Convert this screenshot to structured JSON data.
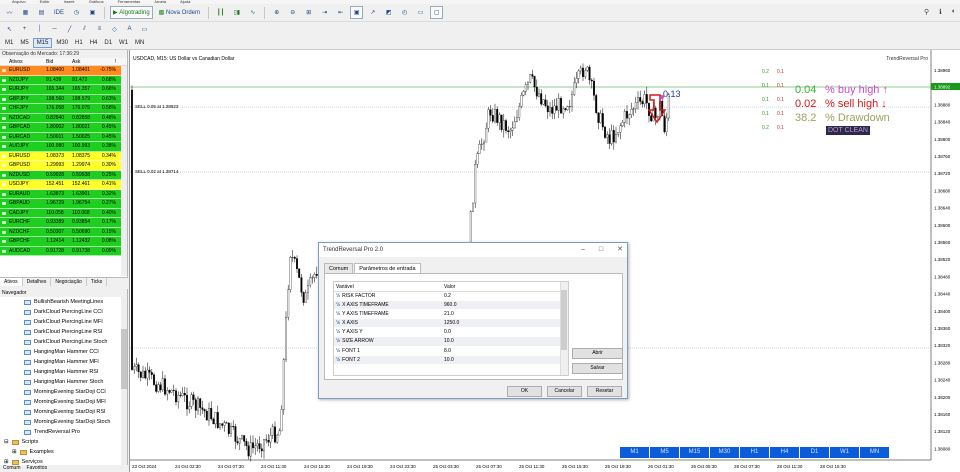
{
  "menu": [
    "Arquivo",
    "Exibir",
    "Inserir",
    "Gráficos",
    "Ferramentas",
    "Janela",
    "Ajuda"
  ],
  "toolbar": {
    "algo_label": "Algotrading",
    "new_order_label": "Nova Ordem",
    "ide_label": "IDE"
  },
  "timeframes": [
    "M1",
    "M5",
    "M15",
    "M30",
    "H1",
    "H4",
    "D1",
    "W1",
    "MN"
  ],
  "active_timeframe": "M15",
  "market_watch": {
    "title": "Observação do Mercado: 17:36:29",
    "headers": [
      "Ativos",
      "Bid",
      "Ask",
      "!"
    ],
    "rows": [
      {
        "symbol": "EURUSD",
        "bid": "1.08400",
        "ask": "1.08401",
        "chg": "-0.75%",
        "color": "#ff8a1e"
      },
      {
        "symbol": "NZDJPY",
        "bid": "91.439",
        "ask": "91.472",
        "chg": "0.68%",
        "color": "#1fcf1f"
      },
      {
        "symbol": "EURJPY",
        "bid": "165.344",
        "ask": "165.357",
        "chg": "0.66%",
        "color": "#1fcf1f"
      },
      {
        "symbol": "GBPJPY",
        "bid": "198.560",
        "ask": "198.579",
        "chg": "0.63%",
        "color": "#1fcf1f"
      },
      {
        "symbol": "CHFJPY",
        "bid": "176.058",
        "ask": "176.075",
        "chg": "0.58%",
        "color": "#1fcf1f"
      },
      {
        "symbol": "NZDCAD",
        "bid": "0.82840",
        "ask": "0.82858",
        "chg": "0.48%",
        "color": "#1fcf1f"
      },
      {
        "symbol": "GBPCAD",
        "bid": "1.80002",
        "ask": "1.80021",
        "chg": "0.45%",
        "color": "#1fcf1f"
      },
      {
        "symbol": "EURCAD",
        "bid": "1.50011",
        "ask": "1.50025",
        "chg": "0.45%",
        "color": "#1fcf1f"
      },
      {
        "symbol": "AUDJPY",
        "bid": "100.980",
        "ask": "100.993",
        "chg": "0.38%",
        "color": "#1fcf1f"
      },
      {
        "symbol": "EURUSD",
        "bid": "1.08373",
        "ask": "1.08375",
        "chg": "0.34%",
        "color": "#ffff2a"
      },
      {
        "symbol": "GBPUSD",
        "bid": "1.29993",
        "ask": "1.29974",
        "chg": "0.30%",
        "color": "#ffff2a"
      },
      {
        "symbol": "NZDUSD",
        "bid": "0.59928",
        "ask": "0.59938",
        "chg": "0.25%",
        "color": "#1fcf1f"
      },
      {
        "symbol": "USDJPY",
        "bid": "152.451",
        "ask": "152.461",
        "chg": "0.41%",
        "color": "#ffff2a"
      },
      {
        "symbol": "EURAUD",
        "bid": "1.63873",
        "ask": "1.63901",
        "chg": "0.32%",
        "color": "#1fcf1f"
      },
      {
        "symbol": "GBPAUD",
        "bid": "1.96729",
        "ask": "1.96754",
        "chg": "0.27%",
        "color": "#1fcf1f"
      },
      {
        "symbol": "CADJPY",
        "bid": "110.058",
        "ask": "110.068",
        "chg": "0.40%",
        "color": "#1fcf1f"
      },
      {
        "symbol": "EURCHF",
        "bid": "0.93389",
        "ask": "0.93854",
        "chg": "0.17%",
        "color": "#1fcf1f"
      },
      {
        "symbol": "NZDCHF",
        "bid": "0.50307",
        "ask": "0.50690",
        "chg": "0.15%",
        "color": "#1fcf1f"
      },
      {
        "symbol": "GBPCHF",
        "bid": "1.12414",
        "ask": "1.12432",
        "chg": "0.08%",
        "color": "#1fcf1f"
      },
      {
        "symbol": "AUDCAD",
        "bid": "0.91728",
        "ask": "0.91738",
        "chg": "0.09%",
        "color": "#1fcf1f"
      }
    ],
    "tabs": [
      "Ativos",
      "Detalhes",
      "Negociação",
      "Ticks"
    ]
  },
  "navigator": {
    "title": "Navegador",
    "items": [
      "BullishBearish MeetingLines",
      "DarkCloud PiercingLine CCI",
      "DarkCloud PiercingLine MFI",
      "DarkCloud PiercingLine RSI",
      "DarkCloud PiercingLine Stoch",
      "HangingMan Hammer CCI",
      "HangingMan Hammer MFI",
      "HangingMan Hammer RSI",
      "HangingMan Hammer Stoch",
      "MorningEvening StarDoji CCI",
      "MorningEvening StarDoji MFI",
      "MorningEvening StarDoji RSI",
      "MorningEvening StarDoji Stoch"
    ],
    "trend_item": "TrendReversal Pro",
    "scripts": "Scripts",
    "examples": "Examples",
    "services": "Serviços"
  },
  "bottom_tabs": [
    "Comum",
    "Favoritos"
  ],
  "chart": {
    "title": "USDCAD, M15: US Dollar vs Canadian Dollar",
    "brand": "TrendReversal Pro",
    "current_price": "1.38892",
    "price_labels": [
      "1.38960",
      "1.38920",
      "1.38880",
      "1.38840",
      "1.38800",
      "1.38760",
      "1.38720",
      "1.38680",
      "1.38640",
      "1.38600",
      "1.38560",
      "1.38520",
      "1.38480",
      "1.38440",
      "1.38400",
      "1.38360",
      "1.38320",
      "1.38280",
      "1.38240",
      "1.38200",
      "1.38160",
      "1.38120",
      "1.38080"
    ],
    "time_labels": [
      "23 Oct 2024",
      "24 Oct 02:30",
      "24 Oct 07:30",
      "24 Oct 11:30",
      "24 Oct 15:30",
      "24 Oct 19:30",
      "24 Oct 23:30",
      "25 Oct 03:30",
      "25 Oct 07:30",
      "25 Oct 11:30",
      "25 Oct 15:30",
      "25 Oct 19:30",
      "26 Oct 01:30",
      "26 Oct 05:30",
      "28 Oct 07:30",
      "28 Oct 11:30",
      "28 Oct 15:30"
    ],
    "sell_label_1": "SELL 0.05 at 1.38923",
    "sell_label_2": "SELL 0.02 at 1.38714",
    "arrow_value": "0.13",
    "side_numbers": [
      [
        "0.2",
        "0.1"
      ],
      [
        "0.1",
        "0.1"
      ],
      [
        "0.1",
        "0.1"
      ],
      [
        "0.1",
        "0.1"
      ],
      [
        "0.2",
        "0.1"
      ]
    ],
    "stats": {
      "buy_val": "0.04",
      "buy_label": "% buy high ↑",
      "sell_val": "0.02",
      "sell_label": "% sell high ↓",
      "dd_val": "38.2",
      "dd_label": "% Drawdown",
      "clean_label": "DOT CLEAN"
    }
  },
  "dialog": {
    "title": "TrendReversal Pro 2.0",
    "tabs": [
      "Comum",
      "Parâmetros de entrada"
    ],
    "headers": [
      "Variável",
      "Valor"
    ],
    "params": [
      {
        "k": "RISK FACTOR",
        "v": "0.2"
      },
      {
        "k": "X AXIS TIMEFRAME",
        "v": "960.0"
      },
      {
        "k": "Y AXIS TIMEFRAME",
        "v": "21.0"
      },
      {
        "k": "X AXIS",
        "v": "1250.0"
      },
      {
        "k": "Y AXIS Y",
        "v": "0.0"
      },
      {
        "k": "SIZE ARROW",
        "v": "10.0"
      },
      {
        "k": "FONT 1",
        "v": "8.0"
      },
      {
        "k": "FONT 2",
        "v": "10.0"
      }
    ],
    "open_btn": "Abrir",
    "save_btn": "Salvar",
    "ok_btn": "OK",
    "cancel_btn": "Cancelar",
    "reset_btn": "Resetar"
  },
  "tf_buttons": [
    "M1",
    "M5",
    "M15",
    "M30",
    "H1",
    "H4",
    "D1",
    "W1",
    "MN"
  ]
}
